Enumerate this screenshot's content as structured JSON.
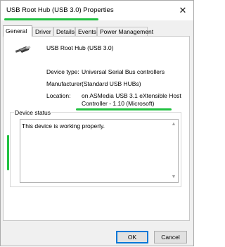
{
  "window": {
    "title": "USB Root Hub (USB 3.0) Properties",
    "close": "✕"
  },
  "tabs": [
    "General",
    "Driver",
    "Details",
    "Events",
    "Power Management"
  ],
  "device": {
    "name": "USB Root Hub (USB 3.0)",
    "type_label": "Device type:",
    "type_value": "Universal Serial Bus controllers",
    "manufacturer_label": "Manufacturer:",
    "manufacturer_value": "(Standard USB HUBs)",
    "location_label": "Location:",
    "location_value_line1": "on ASMedia USB 3.1 eXtensible Host",
    "location_value_line2": "Controller - 1.10 (Microsoft)"
  },
  "status": {
    "group_label": "Device status",
    "text": "This device is working properly."
  },
  "buttons": {
    "ok": "OK",
    "cancel": "Cancel"
  },
  "colors": {
    "highlight": "#21c141",
    "accent": "#0078d7"
  },
  "icons": {
    "device": "usb-plug-icon",
    "scroll_up": "chevron-up-icon",
    "scroll_down": "chevron-down-icon"
  }
}
